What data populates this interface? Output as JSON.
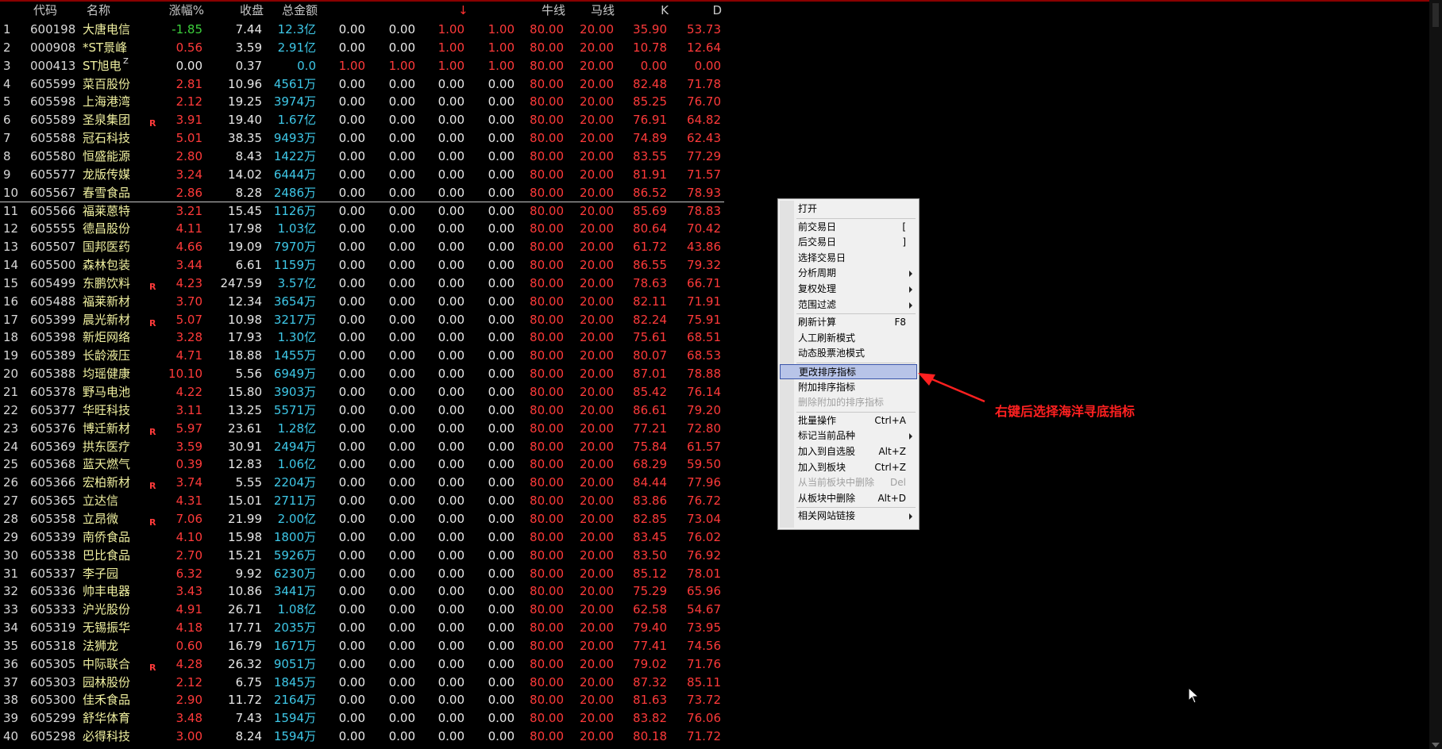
{
  "header": {
    "code": "代码",
    "name": "名称",
    "change": "涨幅%",
    "close": "收盘",
    "amount": "总金额",
    "sort_arrow": "↓",
    "niu": "牛线",
    "ma": "马线",
    "k": "K",
    "d": "D"
  },
  "rows": [
    {
      "i": "1",
      "code": "600198",
      "name": "大唐电信",
      "flag": "",
      "chg": "-1.85",
      "chg_c": "grn",
      "close": "7.44",
      "amt": "12.3亿",
      "v1": "0.00",
      "v1_c": "wht",
      "v2": "0.00",
      "v2_c": "wht",
      "v3": "1.00",
      "v4": "1.00",
      "niu": "80.00",
      "ma": "20.00",
      "k": "35.90",
      "d": "53.73"
    },
    {
      "i": "2",
      "code": "000908",
      "name": "*ST景峰",
      "flag": "",
      "chg": "0.56",
      "chg_c": "red",
      "close": "3.59",
      "amt": "2.91亿",
      "v1": "0.00",
      "v1_c": "wht",
      "v2": "0.00",
      "v2_c": "wht",
      "v3": "1.00",
      "v4": "1.00",
      "niu": "80.00",
      "ma": "20.00",
      "k": "10.78",
      "d": "12.64"
    },
    {
      "i": "3",
      "code": "000413",
      "name": "ST旭电",
      "flag": "Z",
      "chg": "0.00",
      "chg_c": "wht",
      "close": "0.37",
      "amt": "0.0",
      "v1": "1.00",
      "v1_c": "red",
      "v2": "1.00",
      "v2_c": "red",
      "v3": "1.00",
      "v4": "1.00",
      "niu": "80.00",
      "ma": "20.00",
      "k": "0.00",
      "d": "0.00"
    },
    {
      "i": "4",
      "code": "605599",
      "name": "菜百股份",
      "flag": "",
      "chg": "2.81",
      "chg_c": "red",
      "close": "10.96",
      "amt": "4561万",
      "v1": "0.00",
      "v1_c": "wht",
      "v2": "0.00",
      "v2_c": "wht",
      "v3": "0.00",
      "v4": "0.00",
      "niu": "80.00",
      "ma": "20.00",
      "k": "82.48",
      "d": "71.78"
    },
    {
      "i": "5",
      "code": "605598",
      "name": "上海港湾",
      "flag": "",
      "chg": "2.12",
      "chg_c": "red",
      "close": "19.25",
      "amt": "3974万",
      "v1": "0.00",
      "v1_c": "wht",
      "v2": "0.00",
      "v2_c": "wht",
      "v3": "0.00",
      "v4": "0.00",
      "niu": "80.00",
      "ma": "20.00",
      "k": "85.25",
      "d": "76.70"
    },
    {
      "i": "6",
      "code": "605589",
      "name": "圣泉集团",
      "flag": "R",
      "chg": "3.91",
      "chg_c": "red",
      "close": "19.40",
      "amt": "1.67亿",
      "v1": "0.00",
      "v1_c": "wht",
      "v2": "0.00",
      "v2_c": "wht",
      "v3": "0.00",
      "v4": "0.00",
      "niu": "80.00",
      "ma": "20.00",
      "k": "76.91",
      "d": "64.82"
    },
    {
      "i": "7",
      "code": "605588",
      "name": "冠石科技",
      "flag": "",
      "chg": "5.01",
      "chg_c": "red",
      "close": "38.35",
      "amt": "9493万",
      "v1": "0.00",
      "v1_c": "wht",
      "v2": "0.00",
      "v2_c": "wht",
      "v3": "0.00",
      "v4": "0.00",
      "niu": "80.00",
      "ma": "20.00",
      "k": "74.89",
      "d": "62.43"
    },
    {
      "i": "8",
      "code": "605580",
      "name": "恒盛能源",
      "flag": "",
      "chg": "2.80",
      "chg_c": "red",
      "close": "8.43",
      "amt": "1422万",
      "v1": "0.00",
      "v1_c": "wht",
      "v2": "0.00",
      "v2_c": "wht",
      "v3": "0.00",
      "v4": "0.00",
      "niu": "80.00",
      "ma": "20.00",
      "k": "83.55",
      "d": "77.29"
    },
    {
      "i": "9",
      "code": "605577",
      "name": "龙版传媒",
      "flag": "",
      "chg": "3.24",
      "chg_c": "red",
      "close": "14.02",
      "amt": "6444万",
      "v1": "0.00",
      "v1_c": "wht",
      "v2": "0.00",
      "v2_c": "wht",
      "v3": "0.00",
      "v4": "0.00",
      "niu": "80.00",
      "ma": "20.00",
      "k": "81.91",
      "d": "71.57"
    },
    {
      "i": "10",
      "code": "605567",
      "name": "春雪食品",
      "flag": "",
      "chg": "2.86",
      "chg_c": "red",
      "close": "8.28",
      "amt": "2486万",
      "v1": "0.00",
      "v1_c": "wht",
      "v2": "0.00",
      "v2_c": "wht",
      "v3": "0.00",
      "v4": "0.00",
      "niu": "80.00",
      "ma": "20.00",
      "k": "86.52",
      "d": "78.93"
    },
    {
      "i": "11",
      "code": "605566",
      "name": "福莱蒽特",
      "flag": "",
      "chg": "3.21",
      "chg_c": "red",
      "close": "15.45",
      "amt": "1126万",
      "v1": "0.00",
      "v1_c": "wht",
      "v2": "0.00",
      "v2_c": "wht",
      "v3": "0.00",
      "v4": "0.00",
      "niu": "80.00",
      "ma": "20.00",
      "k": "85.69",
      "d": "78.83"
    },
    {
      "i": "12",
      "code": "605555",
      "name": "德昌股份",
      "flag": "",
      "chg": "4.11",
      "chg_c": "red",
      "close": "17.98",
      "amt": "1.03亿",
      "v1": "0.00",
      "v1_c": "wht",
      "v2": "0.00",
      "v2_c": "wht",
      "v3": "0.00",
      "v4": "0.00",
      "niu": "80.00",
      "ma": "20.00",
      "k": "80.64",
      "d": "70.42"
    },
    {
      "i": "13",
      "code": "605507",
      "name": "国邦医药",
      "flag": "",
      "chg": "4.66",
      "chg_c": "red",
      "close": "19.09",
      "amt": "7970万",
      "v1": "0.00",
      "v1_c": "wht",
      "v2": "0.00",
      "v2_c": "wht",
      "v3": "0.00",
      "v4": "0.00",
      "niu": "80.00",
      "ma": "20.00",
      "k": "61.72",
      "d": "43.86"
    },
    {
      "i": "14",
      "code": "605500",
      "name": "森林包装",
      "flag": "",
      "chg": "3.44",
      "chg_c": "red",
      "close": "6.61",
      "amt": "1159万",
      "v1": "0.00",
      "v1_c": "wht",
      "v2": "0.00",
      "v2_c": "wht",
      "v3": "0.00",
      "v4": "0.00",
      "niu": "80.00",
      "ma": "20.00",
      "k": "86.55",
      "d": "79.32"
    },
    {
      "i": "15",
      "code": "605499",
      "name": "东鹏饮料",
      "flag": "R",
      "chg": "4.23",
      "chg_c": "red",
      "close": "247.59",
      "amt": "3.57亿",
      "v1": "0.00",
      "v1_c": "wht",
      "v2": "0.00",
      "v2_c": "wht",
      "v3": "0.00",
      "v4": "0.00",
      "niu": "80.00",
      "ma": "20.00",
      "k": "78.63",
      "d": "66.71"
    },
    {
      "i": "16",
      "code": "605488",
      "name": "福莱新材",
      "flag": "",
      "chg": "3.70",
      "chg_c": "red",
      "close": "12.34",
      "amt": "3654万",
      "v1": "0.00",
      "v1_c": "wht",
      "v2": "0.00",
      "v2_c": "wht",
      "v3": "0.00",
      "v4": "0.00",
      "niu": "80.00",
      "ma": "20.00",
      "k": "82.11",
      "d": "71.91"
    },
    {
      "i": "17",
      "code": "605399",
      "name": "晨光新材",
      "flag": "R",
      "chg": "5.07",
      "chg_c": "red",
      "close": "10.98",
      "amt": "3217万",
      "v1": "0.00",
      "v1_c": "wht",
      "v2": "0.00",
      "v2_c": "wht",
      "v3": "0.00",
      "v4": "0.00",
      "niu": "80.00",
      "ma": "20.00",
      "k": "82.24",
      "d": "75.91"
    },
    {
      "i": "18",
      "code": "605398",
      "name": "新炬网络",
      "flag": "",
      "chg": "3.28",
      "chg_c": "red",
      "close": "17.93",
      "amt": "1.30亿",
      "v1": "0.00",
      "v1_c": "wht",
      "v2": "0.00",
      "v2_c": "wht",
      "v3": "0.00",
      "v4": "0.00",
      "niu": "80.00",
      "ma": "20.00",
      "k": "75.61",
      "d": "68.51"
    },
    {
      "i": "19",
      "code": "605389",
      "name": "长龄液压",
      "flag": "",
      "chg": "4.71",
      "chg_c": "red",
      "close": "18.88",
      "amt": "1455万",
      "v1": "0.00",
      "v1_c": "wht",
      "v2": "0.00",
      "v2_c": "wht",
      "v3": "0.00",
      "v4": "0.00",
      "niu": "80.00",
      "ma": "20.00",
      "k": "80.07",
      "d": "68.53"
    },
    {
      "i": "20",
      "code": "605388",
      "name": "均瑶健康",
      "flag": "",
      "chg": "10.10",
      "chg_c": "red",
      "close": "5.56",
      "amt": "6949万",
      "v1": "0.00",
      "v1_c": "wht",
      "v2": "0.00",
      "v2_c": "wht",
      "v3": "0.00",
      "v4": "0.00",
      "niu": "80.00",
      "ma": "20.00",
      "k": "87.01",
      "d": "78.88"
    },
    {
      "i": "21",
      "code": "605378",
      "name": "野马电池",
      "flag": "",
      "chg": "4.22",
      "chg_c": "red",
      "close": "15.80",
      "amt": "3903万",
      "v1": "0.00",
      "v1_c": "wht",
      "v2": "0.00",
      "v2_c": "wht",
      "v3": "0.00",
      "v4": "0.00",
      "niu": "80.00",
      "ma": "20.00",
      "k": "85.42",
      "d": "76.14"
    },
    {
      "i": "22",
      "code": "605377",
      "name": "华旺科技",
      "flag": "",
      "chg": "3.11",
      "chg_c": "red",
      "close": "13.25",
      "amt": "5571万",
      "v1": "0.00",
      "v1_c": "wht",
      "v2": "0.00",
      "v2_c": "wht",
      "v3": "0.00",
      "v4": "0.00",
      "niu": "80.00",
      "ma": "20.00",
      "k": "86.61",
      "d": "79.20"
    },
    {
      "i": "23",
      "code": "605376",
      "name": "博迁新材",
      "flag": "R",
      "chg": "5.97",
      "chg_c": "red",
      "close": "23.61",
      "amt": "1.28亿",
      "v1": "0.00",
      "v1_c": "wht",
      "v2": "0.00",
      "v2_c": "wht",
      "v3": "0.00",
      "v4": "0.00",
      "niu": "80.00",
      "ma": "20.00",
      "k": "77.21",
      "d": "72.80"
    },
    {
      "i": "24",
      "code": "605369",
      "name": "拱东医疗",
      "flag": "",
      "chg": "3.59",
      "chg_c": "red",
      "close": "30.91",
      "amt": "2494万",
      "v1": "0.00",
      "v1_c": "wht",
      "v2": "0.00",
      "v2_c": "wht",
      "v3": "0.00",
      "v4": "0.00",
      "niu": "80.00",
      "ma": "20.00",
      "k": "75.84",
      "d": "61.57"
    },
    {
      "i": "25",
      "code": "605368",
      "name": "蓝天燃气",
      "flag": "",
      "chg": "0.39",
      "chg_c": "red",
      "close": "12.83",
      "amt": "1.06亿",
      "v1": "0.00",
      "v1_c": "wht",
      "v2": "0.00",
      "v2_c": "wht",
      "v3": "0.00",
      "v4": "0.00",
      "niu": "80.00",
      "ma": "20.00",
      "k": "68.29",
      "d": "59.50"
    },
    {
      "i": "26",
      "code": "605366",
      "name": "宏柏新材",
      "flag": "R",
      "chg": "3.74",
      "chg_c": "red",
      "close": "5.55",
      "amt": "2204万",
      "v1": "0.00",
      "v1_c": "wht",
      "v2": "0.00",
      "v2_c": "wht",
      "v3": "0.00",
      "v4": "0.00",
      "niu": "80.00",
      "ma": "20.00",
      "k": "84.44",
      "d": "77.96"
    },
    {
      "i": "27",
      "code": "605365",
      "name": "立达信",
      "flag": "",
      "chg": "4.31",
      "chg_c": "red",
      "close": "15.01",
      "amt": "2711万",
      "v1": "0.00",
      "v1_c": "wht",
      "v2": "0.00",
      "v2_c": "wht",
      "v3": "0.00",
      "v4": "0.00",
      "niu": "80.00",
      "ma": "20.00",
      "k": "83.86",
      "d": "76.72"
    },
    {
      "i": "28",
      "code": "605358",
      "name": "立昂微",
      "flag": "R",
      "chg": "7.06",
      "chg_c": "red",
      "close": "21.99",
      "amt": "2.00亿",
      "v1": "0.00",
      "v1_c": "wht",
      "v2": "0.00",
      "v2_c": "wht",
      "v3": "0.00",
      "v4": "0.00",
      "niu": "80.00",
      "ma": "20.00",
      "k": "82.85",
      "d": "73.04"
    },
    {
      "i": "29",
      "code": "605339",
      "name": "南侨食品",
      "flag": "",
      "chg": "4.10",
      "chg_c": "red",
      "close": "15.98",
      "amt": "1800万",
      "v1": "0.00",
      "v1_c": "wht",
      "v2": "0.00",
      "v2_c": "wht",
      "v3": "0.00",
      "v4": "0.00",
      "niu": "80.00",
      "ma": "20.00",
      "k": "83.45",
      "d": "76.02"
    },
    {
      "i": "30",
      "code": "605338",
      "name": "巴比食品",
      "flag": "",
      "chg": "2.70",
      "chg_c": "red",
      "close": "15.21",
      "amt": "5926万",
      "v1": "0.00",
      "v1_c": "wht",
      "v2": "0.00",
      "v2_c": "wht",
      "v3": "0.00",
      "v4": "0.00",
      "niu": "80.00",
      "ma": "20.00",
      "k": "83.50",
      "d": "76.92"
    },
    {
      "i": "31",
      "code": "605337",
      "name": "李子园",
      "flag": "",
      "chg": "6.32",
      "chg_c": "red",
      "close": "9.92",
      "amt": "6230万",
      "v1": "0.00",
      "v1_c": "wht",
      "v2": "0.00",
      "v2_c": "wht",
      "v3": "0.00",
      "v4": "0.00",
      "niu": "80.00",
      "ma": "20.00",
      "k": "85.12",
      "d": "78.01"
    },
    {
      "i": "32",
      "code": "605336",
      "name": "帅丰电器",
      "flag": "",
      "chg": "3.43",
      "chg_c": "red",
      "close": "10.86",
      "amt": "3441万",
      "v1": "0.00",
      "v1_c": "wht",
      "v2": "0.00",
      "v2_c": "wht",
      "v3": "0.00",
      "v4": "0.00",
      "niu": "80.00",
      "ma": "20.00",
      "k": "75.29",
      "d": "65.96"
    },
    {
      "i": "33",
      "code": "605333",
      "name": "沪光股份",
      "flag": "",
      "chg": "4.91",
      "chg_c": "red",
      "close": "26.71",
      "amt": "1.08亿",
      "v1": "0.00",
      "v1_c": "wht",
      "v2": "0.00",
      "v2_c": "wht",
      "v3": "0.00",
      "v4": "0.00",
      "niu": "80.00",
      "ma": "20.00",
      "k": "62.58",
      "d": "54.67"
    },
    {
      "i": "34",
      "code": "605319",
      "name": "无锡振华",
      "flag": "",
      "chg": "4.18",
      "chg_c": "red",
      "close": "17.71",
      "amt": "2035万",
      "v1": "0.00",
      "v1_c": "wht",
      "v2": "0.00",
      "v2_c": "wht",
      "v3": "0.00",
      "v4": "0.00",
      "niu": "80.00",
      "ma": "20.00",
      "k": "79.40",
      "d": "73.95"
    },
    {
      "i": "35",
      "code": "605318",
      "name": "法狮龙",
      "flag": "",
      "chg": "0.60",
      "chg_c": "red",
      "close": "16.79",
      "amt": "1671万",
      "v1": "0.00",
      "v1_c": "wht",
      "v2": "0.00",
      "v2_c": "wht",
      "v3": "0.00",
      "v4": "0.00",
      "niu": "80.00",
      "ma": "20.00",
      "k": "77.41",
      "d": "74.56"
    },
    {
      "i": "36",
      "code": "605305",
      "name": "中际联合",
      "flag": "R",
      "chg": "4.28",
      "chg_c": "red",
      "close": "26.32",
      "amt": "9051万",
      "v1": "0.00",
      "v1_c": "wht",
      "v2": "0.00",
      "v2_c": "wht",
      "v3": "0.00",
      "v4": "0.00",
      "niu": "80.00",
      "ma": "20.00",
      "k": "79.02",
      "d": "71.76"
    },
    {
      "i": "37",
      "code": "605303",
      "name": "园林股份",
      "flag": "",
      "chg": "2.12",
      "chg_c": "red",
      "close": "6.75",
      "amt": "1845万",
      "v1": "0.00",
      "v1_c": "wht",
      "v2": "0.00",
      "v2_c": "wht",
      "v3": "0.00",
      "v4": "0.00",
      "niu": "80.00",
      "ma": "20.00",
      "k": "87.32",
      "d": "85.11"
    },
    {
      "i": "38",
      "code": "605300",
      "name": "佳禾食品",
      "flag": "",
      "chg": "2.90",
      "chg_c": "red",
      "close": "11.72",
      "amt": "2164万",
      "v1": "0.00",
      "v1_c": "wht",
      "v2": "0.00",
      "v2_c": "wht",
      "v3": "0.00",
      "v4": "0.00",
      "niu": "80.00",
      "ma": "20.00",
      "k": "81.63",
      "d": "73.72"
    },
    {
      "i": "39",
      "code": "605299",
      "name": "舒华体育",
      "flag": "",
      "chg": "3.48",
      "chg_c": "red",
      "close": "7.43",
      "amt": "1594万",
      "v1": "0.00",
      "v1_c": "wht",
      "v2": "0.00",
      "v2_c": "wht",
      "v3": "0.00",
      "v4": "0.00",
      "niu": "80.00",
      "ma": "20.00",
      "k": "83.82",
      "d": "76.06"
    },
    {
      "i": "40",
      "code": "605298",
      "name": "必得科技",
      "flag": "",
      "chg": "3.00",
      "chg_c": "red",
      "close": "8.24",
      "amt": "1594万",
      "v1": "0.00",
      "v1_c": "wht",
      "v2": "0.00",
      "v2_c": "wht",
      "v3": "0.00",
      "v4": "0.00",
      "niu": "80.00",
      "ma": "20.00",
      "k": "80.18",
      "d": "71.72"
    }
  ],
  "menu": {
    "items": [
      {
        "label": "打开",
        "shortcut": "",
        "sub": false,
        "disabled": false,
        "sep_after": true
      },
      {
        "label": "前交易日",
        "shortcut": "[",
        "sub": false,
        "disabled": false,
        "sep_after": false
      },
      {
        "label": "后交易日",
        "shortcut": "]",
        "sub": false,
        "disabled": false,
        "sep_after": false
      },
      {
        "label": "选择交易日",
        "shortcut": "",
        "sub": false,
        "disabled": false,
        "sep_after": false
      },
      {
        "label": "分析周期",
        "shortcut": "",
        "sub": true,
        "disabled": false,
        "sep_after": false
      },
      {
        "label": "复权处理",
        "shortcut": "",
        "sub": true,
        "disabled": false,
        "sep_after": false
      },
      {
        "label": "范围过滤",
        "shortcut": "",
        "sub": true,
        "disabled": false,
        "sep_after": true
      },
      {
        "label": "刷新计算",
        "shortcut": "F8",
        "sub": false,
        "disabled": false,
        "sep_after": false
      },
      {
        "label": "人工刷新模式",
        "shortcut": "",
        "sub": false,
        "disabled": false,
        "sep_after": false
      },
      {
        "label": "动态股票池模式",
        "shortcut": "",
        "sub": false,
        "disabled": false,
        "sep_after": true
      },
      {
        "label": "更改排序指标",
        "shortcut": "",
        "sub": false,
        "disabled": false,
        "sep_after": false,
        "highlighted": true
      },
      {
        "label": "附加排序指标",
        "shortcut": "",
        "sub": false,
        "disabled": false,
        "sep_after": false
      },
      {
        "label": "删除附加的排序指标",
        "shortcut": "",
        "sub": false,
        "disabled": true,
        "sep_after": true
      },
      {
        "label": "批量操作",
        "shortcut": "Ctrl+A",
        "sub": false,
        "disabled": false,
        "sep_after": false
      },
      {
        "label": "标记当前品种",
        "shortcut": "",
        "sub": true,
        "disabled": false,
        "sep_after": false
      },
      {
        "label": "加入到自选股",
        "shortcut": "Alt+Z",
        "sub": false,
        "disabled": false,
        "sep_after": false
      },
      {
        "label": "加入到板块",
        "shortcut": "Ctrl+Z",
        "sub": false,
        "disabled": false,
        "sep_after": false
      },
      {
        "label": "从当前板块中删除",
        "shortcut": "Del",
        "sub": false,
        "disabled": true,
        "sep_after": false
      },
      {
        "label": "从板块中删除",
        "shortcut": "Alt+D",
        "sub": false,
        "disabled": false,
        "sep_after": true
      },
      {
        "label": "相关网站链接",
        "shortcut": "",
        "sub": true,
        "disabled": false,
        "sep_after": false
      }
    ]
  },
  "annotation": {
    "text": "右键后选择海洋寻底指标",
    "color": "#ff2020"
  },
  "colors": {
    "red": "#ff3a3a",
    "green": "#3ccf3c",
    "cyan": "#3ec8e8",
    "name_yellow": "#f0f0a0",
    "highlight": "#b8c4e8"
  }
}
